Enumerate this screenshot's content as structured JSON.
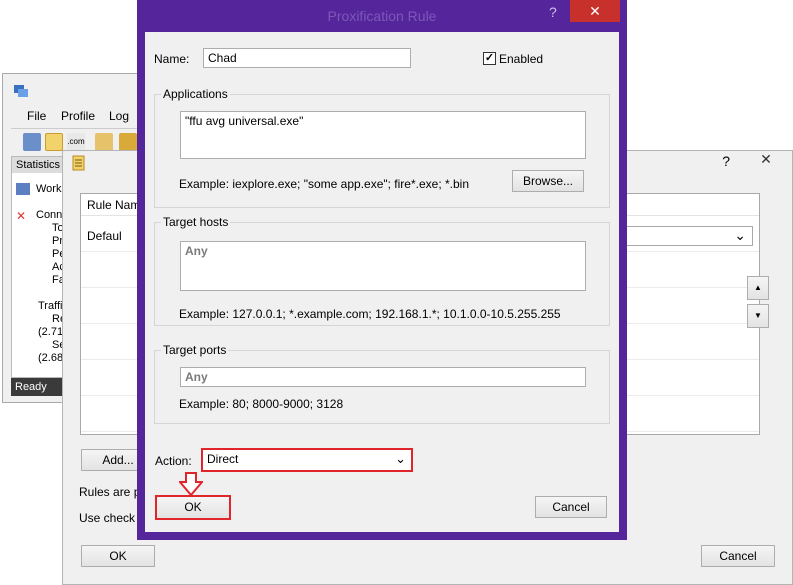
{
  "main_window": {
    "menu": [
      "File",
      "Profile",
      "Log"
    ],
    "tree_header": "Statistics",
    "tree_items": [
      "Work",
      "Conn",
      "To",
      "Pr",
      "Pe",
      "Ac",
      "Fa",
      "Traffi",
      "Re",
      "(2.71",
      "Se",
      "(2.68"
    ],
    "status": "Ready"
  },
  "rules_window": {
    "help": "?",
    "close": "✕",
    "column_header": "Rule Name",
    "default_label": "Defaul",
    "add_button": "Add...",
    "info_line1": "Rules are pr",
    "info_line2": "Use check b",
    "ok_button": "OK",
    "cancel_button": "Cancel",
    "up_glyph": "▲",
    "down_glyph": "▼",
    "select_arrow": "⌄"
  },
  "dialog": {
    "title": "Proxification Rule",
    "help": "?",
    "close": "✕",
    "name_label": "Name:",
    "name_value": "Chad",
    "enabled_label": "Enabled",
    "enabled_checked": true,
    "check_glyph": "✓",
    "applications": {
      "label": "Applications",
      "value": "\"ffu avg universal.exe\"",
      "example": "Example: iexplore.exe; \"some app.exe\"; fire*.exe; *.bin",
      "browse_button": "Browse..."
    },
    "target_hosts": {
      "label": "Target hosts",
      "value": "Any",
      "example": "Example: 127.0.0.1; *.example.com; 192.168.1.*; 10.1.0.0-10.5.255.255"
    },
    "target_ports": {
      "label": "Target ports",
      "value": "Any",
      "example": "Example: 80; 8000-9000; 3128"
    },
    "action_label": "Action:",
    "action_value": "Direct",
    "select_arrow": "⌄",
    "ok_button": "OK",
    "cancel_button": "Cancel"
  },
  "colors": {
    "dialog_frame": "#55259b",
    "close_red": "#c7302b",
    "highlight_red": "#e0252b"
  }
}
